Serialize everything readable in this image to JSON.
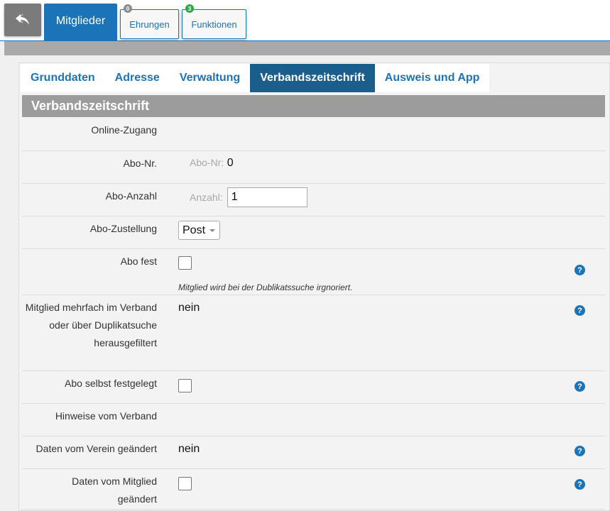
{
  "header": {
    "back_icon": "reply-arrow-icon",
    "tabs": [
      {
        "label": "Mitglieder",
        "active": true
      },
      {
        "label": "Ehrungen",
        "badge": "0",
        "badge_color": "#8c8c8c"
      },
      {
        "label": "Funktionen",
        "badge": "3",
        "badge_color": "#2fa84f"
      }
    ]
  },
  "section_tabs": [
    "Grunddaten",
    "Adresse",
    "Verwaltung",
    "Verbandszeitschrift",
    "Ausweis und App"
  ],
  "active_section": "Verbandszeitschrift",
  "section_title": "Verbandszeitschrift",
  "fields": {
    "online_zugang": {
      "label": "Online-Zugang"
    },
    "abo_nr": {
      "label": "Abo-Nr.",
      "prefix": "Abo-Nr:",
      "value": "0"
    },
    "abo_anzahl": {
      "label": "Abo-Anzahl",
      "prefix": "Anzahl:",
      "value": "1"
    },
    "abo_zustellung": {
      "label": "Abo-Zustellung",
      "value": "Post"
    },
    "abo_fest": {
      "label": "Abo fest",
      "checked": false,
      "hint": "Mitglied wird bei der Dublikatssuche irgnoriert."
    },
    "mehrfach": {
      "label": "Mitglied mehrfach im Verband oder über Duplikatsuche herausgefiltert",
      "value": "nein"
    },
    "abo_selbst": {
      "label": "Abo selbst festgelegt",
      "checked": false
    },
    "hinweise": {
      "label": "Hinweise vom Verband"
    },
    "daten_verein": {
      "label": "Daten vom Verein geändert",
      "value": "nein"
    },
    "daten_mitglied": {
      "label": "Daten vom Mitglied geändert",
      "checked": false
    }
  },
  "help_symbol": "?",
  "colors": {
    "primary": "#1b74b8",
    "active_section": "#1b5e8c",
    "title_bar": "#9c9c9c"
  }
}
